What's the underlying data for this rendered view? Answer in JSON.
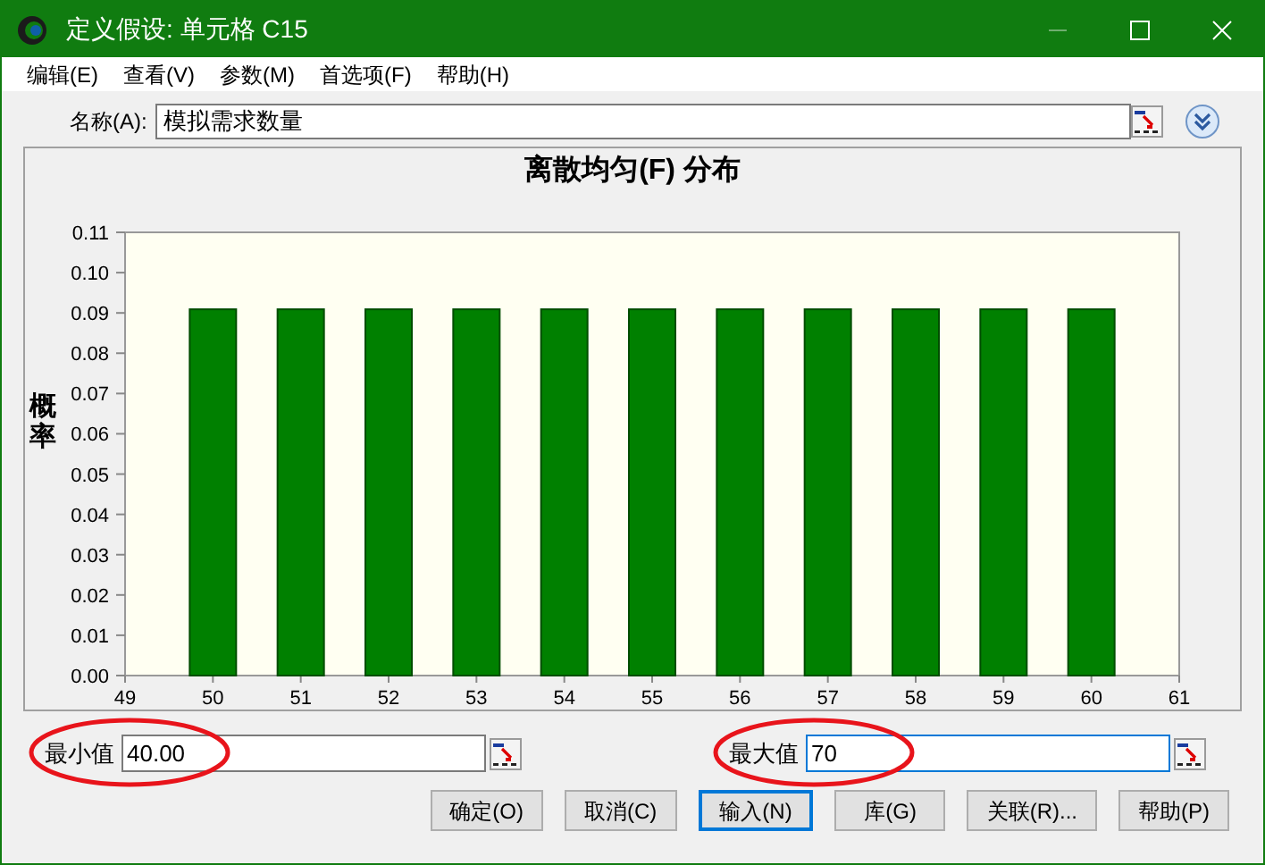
{
  "window": {
    "title": "定义假设: 单元格 C15"
  },
  "menu": [
    "编辑(E)",
    "查看(V)",
    "参数(M)",
    "首选项(F)",
    "帮助(H)"
  ],
  "name_field": {
    "label": "名称(A):",
    "value": "模拟需求数量"
  },
  "chart": {
    "chart_data": {
      "type": "bar",
      "title": "离散均匀(F) 分布",
      "ylabel": "概率",
      "x": [
        50,
        51,
        52,
        53,
        54,
        55,
        56,
        57,
        58,
        59,
        60
      ],
      "series": [
        {
          "color": "#008000",
          "values": [
            0.0909,
            0.0909,
            0.0909,
            0.0909,
            0.0909,
            0.0909,
            0.0909,
            0.0909,
            0.0909,
            0.0909,
            0.0909
          ]
        }
      ],
      "xlim": [
        49,
        61
      ],
      "ylim": [
        0,
        0.11
      ],
      "xticks": [
        49,
        50,
        51,
        52,
        53,
        54,
        55,
        56,
        57,
        58,
        59,
        60,
        61
      ],
      "yticks": [
        {
          "value": 0,
          "label": "0.00"
        },
        {
          "value": 0.01,
          "label": "0.01"
        },
        {
          "value": 0.02,
          "label": "0.02"
        },
        {
          "value": 0.03,
          "label": "0.03"
        },
        {
          "value": 0.04,
          "label": "0.04"
        },
        {
          "value": 0.05,
          "label": "0.05"
        },
        {
          "value": 0.06,
          "label": "0.06"
        },
        {
          "value": 0.07,
          "label": "0.07"
        },
        {
          "value": 0.08,
          "label": "0.08"
        },
        {
          "value": 0.09,
          "label": "0.09"
        },
        {
          "value": 0.1,
          "label": "0.10"
        },
        {
          "value": 0.11,
          "label": "0.11"
        }
      ]
    }
  },
  "min_field": {
    "label": "最小值",
    "value": "40.00",
    "circled": true,
    "focused": false
  },
  "max_field": {
    "label": "最大值",
    "value": "70",
    "circled": true,
    "focused": true
  },
  "buttons": [
    {
      "label": "确定(O)",
      "default": false
    },
    {
      "label": "取消(C)",
      "default": false
    },
    {
      "label": "输入(N)",
      "default": true
    },
    {
      "label": "库(G)",
      "default": false
    },
    {
      "label": "关联(R)...",
      "default": false
    },
    {
      "label": "帮助(P)",
      "default": false
    }
  ]
}
